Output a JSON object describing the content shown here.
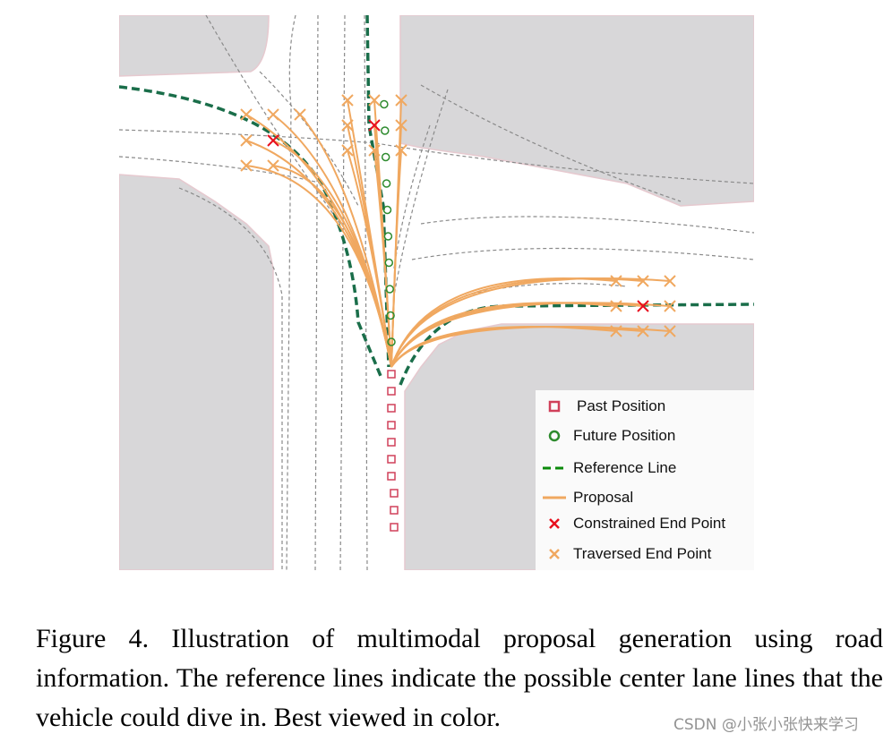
{
  "figure": {
    "colors": {
      "building": "#d8d7d9",
      "building_edge": "#e6c9cf",
      "road": "#ffffff",
      "lane_line": "#8a8a8a",
      "past_position": "#d0405a",
      "future_position": "#2e8b2e",
      "reference_line": "#1a6e4a",
      "proposal": "#f0a860",
      "constrained_end_point": "#e8101e",
      "traversed_end_point": "#f0a860"
    },
    "legend": [
      {
        "label": "Past Position",
        "icon": "square-marker"
      },
      {
        "label": "Future Position",
        "icon": "circle-marker"
      },
      {
        "label": "Reference Line",
        "icon": "dashed-line"
      },
      {
        "label": "Proposal",
        "icon": "solid-line"
      },
      {
        "label": "Constrained End Point",
        "icon": "x-marker"
      },
      {
        "label": "Traversed End Point",
        "icon": "x-marker"
      }
    ]
  },
  "caption": "Figure 4. Illustration of multimodal proposal generation using road information. The reference lines indicate the possible center lane lines that the vehicle could dive in. Best viewed in color.",
  "watermark": "CSDN @小张小张快来学习"
}
